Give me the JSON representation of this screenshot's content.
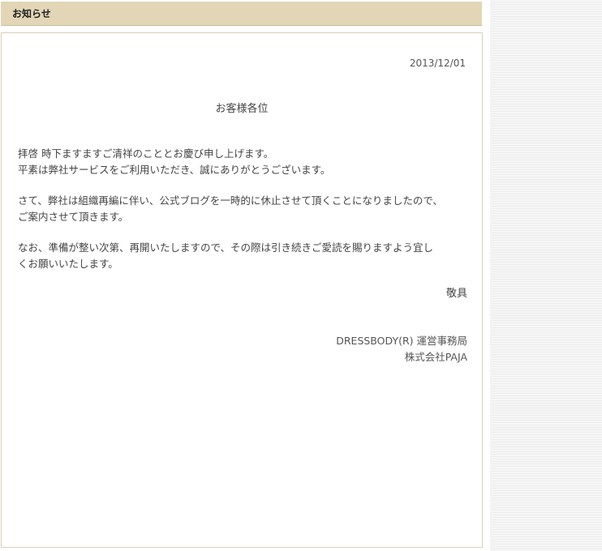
{
  "header": {
    "title": "お知らせ"
  },
  "notice": {
    "date": "2013/12/01",
    "salutation": "お客様各位",
    "paragraph1": [
      "拝啓 時下ますますご清祥のこととお慶び申し上げます。",
      "平素は弊社サービスをご利用いただき、誠にありがとうございます。"
    ],
    "paragraph2": [
      "さて、弊社は組織再編に伴い、公式ブログを一時的に休止させて頂くことになりましたので、",
      "ご案内させて頂きます。"
    ],
    "paragraph3": [
      "なお、準備が整い次第、再開いたしますので、その際は引き続きご愛読を賜りますよう宜し",
      "くお願いいたします。"
    ],
    "closing": "敬具",
    "signature": {
      "organization": "DRESSBODY(R) 運営事務局",
      "company": "株式会社PAJA"
    }
  },
  "colors": {
    "header_bg": "#e2d6b6",
    "box_border": "#d8cfba",
    "text": "#444444"
  }
}
